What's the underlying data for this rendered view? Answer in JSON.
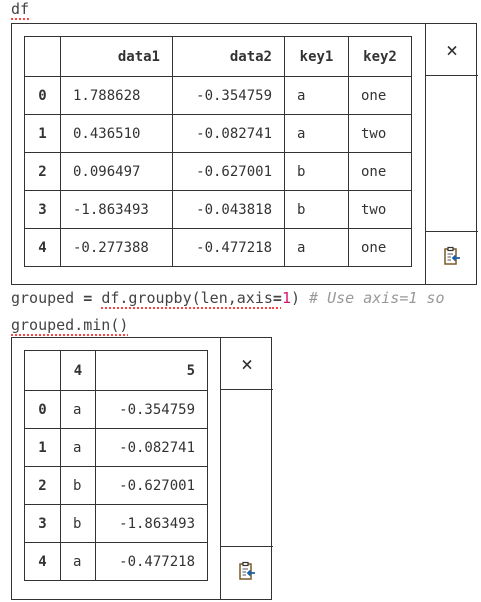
{
  "cells": {
    "line1": "df",
    "line2": {
      "var": "grouped",
      "eq": " = ",
      "call": "df.groupby(len,axis",
      "op": "=",
      "num": "1",
      "close": ")",
      "comment": " # Use axis=1 so"
    },
    "line3": "grouped.min()"
  },
  "df_table": {
    "headers": [
      "",
      "data1",
      "data2",
      "key1",
      "key2"
    ],
    "rows": [
      [
        "0",
        "1.788628",
        "-0.354759",
        "a",
        "one"
      ],
      [
        "1",
        "0.436510",
        "-0.082741",
        "a",
        "two"
      ],
      [
        "2",
        "0.096497",
        "-0.627001",
        "b",
        "one"
      ],
      [
        "3",
        "-1.863493",
        "-0.043818",
        "b",
        "two"
      ],
      [
        "4",
        "-0.277388",
        "-0.477218",
        "a",
        "one"
      ]
    ]
  },
  "min_table": {
    "headers": [
      "",
      "4",
      "5"
    ],
    "rows": [
      [
        "0",
        "a",
        "-0.354759"
      ],
      [
        "1",
        "a",
        "-0.082741"
      ],
      [
        "2",
        "b",
        "-0.627001"
      ],
      [
        "3",
        "b",
        "-1.863493"
      ],
      [
        "4",
        "a",
        "-0.477218"
      ]
    ]
  },
  "icons": {
    "close": "×"
  }
}
